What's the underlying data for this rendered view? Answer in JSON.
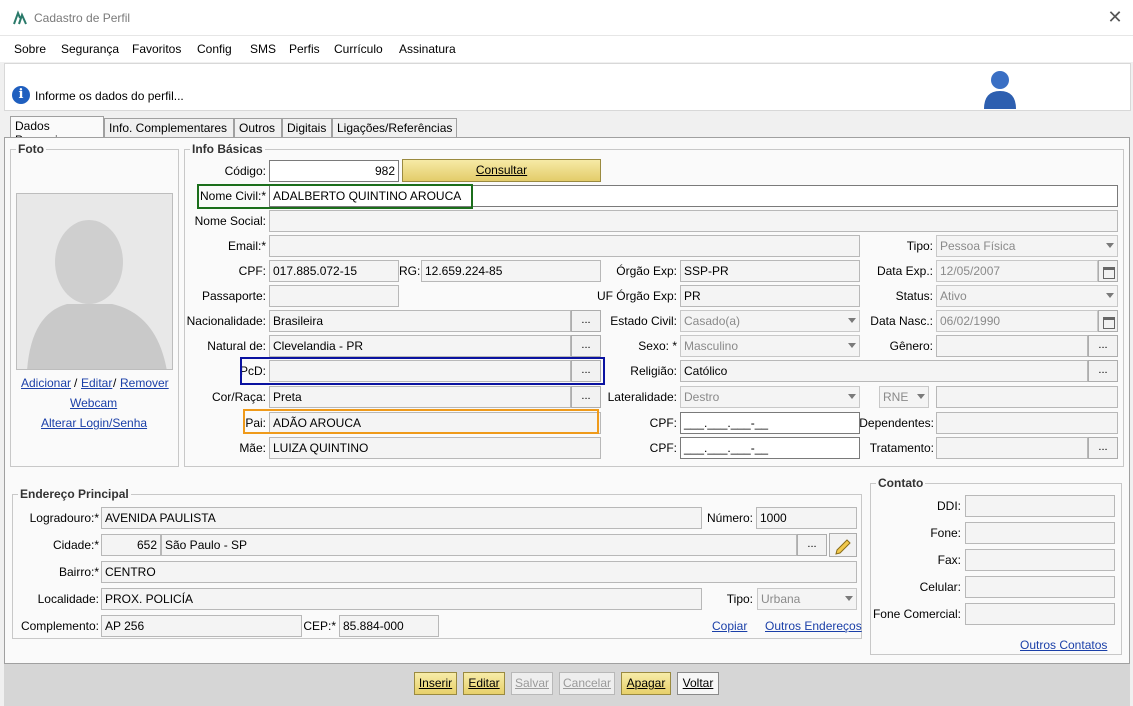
{
  "window": {
    "title": "Cadastro de Perfil"
  },
  "menu": [
    {
      "label": "Sobre"
    },
    {
      "label": "Segurança"
    },
    {
      "label": "Favoritos"
    },
    {
      "label": "Config"
    },
    {
      "label": "SMS"
    },
    {
      "label": "Perfis"
    },
    {
      "label": "Currículo"
    },
    {
      "label": "Assinatura"
    }
  ],
  "banner": {
    "text": "Informe os dados do perfil..."
  },
  "tabs": [
    {
      "label": "Dados Pessoais"
    },
    {
      "label": "Info. Complementares"
    },
    {
      "label": "Outros"
    },
    {
      "label": "Digitais"
    },
    {
      "label": "Ligações/Referências"
    }
  ],
  "foto": {
    "title": "Foto",
    "links": {
      "adicionar": "Adicionar",
      "sep1": "/",
      "editar": "Editar",
      "sep2": "/",
      "remover": "Remover",
      "webcam": "Webcam",
      "alterar_login": "Alterar Login/Senha"
    }
  },
  "info": {
    "title": "Info Básicas",
    "labels": {
      "codigo": "Código:",
      "nome_civil": "Nome Civil:*",
      "nome_social": "Nome Social:",
      "email": "Email:*",
      "tipo": "Tipo:",
      "cpf": "CPF:",
      "rg": "RG:",
      "orgao_exp": "Órgão Exp:",
      "data_exp": "Data Exp.:",
      "passaporte": "Passaporte:",
      "uf_orgao": "UF Órgão Exp:",
      "status": "Status:",
      "nacionalidade": "Nacionalidade:",
      "estado_civil": "Estado Civil:",
      "data_nasc": "Data Nasc.:",
      "natural": "Natural de:",
      "sexo": "Sexo: *",
      "genero": "Gênero:",
      "pcd": "PcD:",
      "religiao": "Religião:",
      "cor": "Cor/Raça:",
      "lateralidade": "Lateralidade:",
      "pai": "Pai:",
      "cpf_pai": "CPF:",
      "dependentes": "Dependentes:",
      "mae": "Mãe:",
      "cpf_mae": "CPF:",
      "tratamento": "Tratamento:"
    },
    "values": {
      "codigo": "982",
      "nome_civil": "ADALBERTO QUINTINO AROUCA",
      "nome_social": "",
      "email": "",
      "tipo": "Pessoa Física",
      "cpf": "017.885.072-15",
      "rg": "12.659.224-85",
      "orgao_exp": "SSP-PR",
      "data_exp": "12/05/2007",
      "passaporte": "",
      "uf_orgao": "PR",
      "status": "Ativo",
      "nacionalidade": "Brasileira",
      "estado_civil": "Casado(a)",
      "data_nasc": "06/02/1990",
      "natural": "Clevelandia - PR",
      "sexo": "Masculino",
      "genero": "",
      "pcd": "",
      "religiao": "Católico",
      "cor": "Preta",
      "lateralidade": "Destro",
      "rne": "RNE",
      "rne_value": "",
      "pai": "ADÃO AROUCA",
      "cpf_pai": "___.___.___-__",
      "dependentes": "",
      "mae": "LUIZA QUINTINO",
      "cpf_mae": "___.___.___-__",
      "tratamento": ""
    },
    "consultar": "Consultar",
    "dots": "..."
  },
  "endereco": {
    "title": "Endereço Principal",
    "labels": {
      "logradouro": "Logradouro:*",
      "numero": "Número:",
      "cidade": "Cidade:*",
      "bairro": "Bairro:*",
      "localidade": "Localidade:",
      "tipo": "Tipo:",
      "complemento": "Complemento:",
      "cep": "CEP:*"
    },
    "values": {
      "logradouro": "AVENIDA PAULISTA",
      "numero": "1000",
      "cidade_cod": "652",
      "cidade": "São Paulo - SP",
      "bairro": "CENTRO",
      "localidade": "PROX. POLICÍA",
      "tipo": "Urbana",
      "complemento": "AP 256",
      "cep": "85.884-000"
    },
    "links": {
      "copiar": "Copiar",
      "outros": "Outros Endereços"
    }
  },
  "contato": {
    "title": "Contato",
    "labels": {
      "ddi": "DDI:",
      "fone": "Fone:",
      "fax": "Fax:",
      "celular": "Celular:",
      "fone_comercial": "Fone Comercial:"
    },
    "values": {
      "ddi": "",
      "fone": "",
      "fax": "",
      "celular": "",
      "fone_comercial": ""
    },
    "links": {
      "outros": "Outros Contatos"
    }
  },
  "footer": {
    "inserir": "Inserir",
    "editar": "Editar",
    "salvar": "Salvar",
    "cancelar": "Cancelar",
    "apagar": "Apagar",
    "voltar": "Voltar"
  },
  "colors": {
    "highlight_green": "#1b6e1b",
    "highlight_blue": "#0a12a0",
    "highlight_orange": "#ef9a1a",
    "gold_button": "#e9d57a",
    "link": "#1a3fa8"
  }
}
